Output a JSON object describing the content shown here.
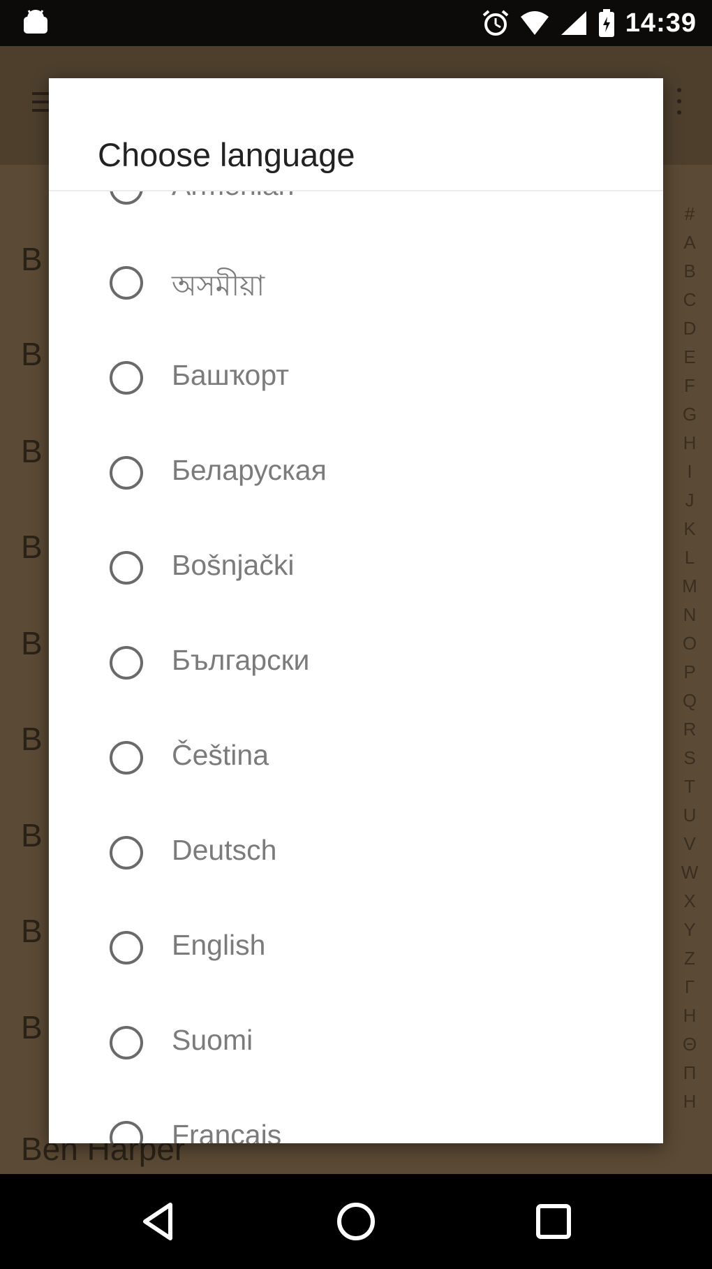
{
  "status_bar": {
    "time": "14:39",
    "icons": [
      "android-icon",
      "alarm-icon",
      "wifi-icon",
      "signal-icon",
      "battery-icon"
    ]
  },
  "background_app": {
    "artists": [
      "B",
      "B",
      "B",
      "B",
      "B",
      "B",
      "B",
      "B",
      "B",
      "Ben Harper"
    ],
    "index_letters": [
      "#",
      "A",
      "B",
      "C",
      "D",
      "E",
      "F",
      "G",
      "H",
      "I",
      "J",
      "K",
      "L",
      "M",
      "N",
      "O",
      "P",
      "Q",
      "R",
      "S",
      "T",
      "U",
      "V",
      "W",
      "X",
      "Y",
      "Z",
      "Γ",
      "Η",
      "Θ",
      "Π",
      "Η"
    ]
  },
  "dialog": {
    "title": "Choose language",
    "options": [
      {
        "label": "Armenian",
        "selected": false
      },
      {
        "label": "অসমীয়া",
        "selected": false
      },
      {
        "label": "Башҡорт",
        "selected": false
      },
      {
        "label": "Беларуская",
        "selected": false
      },
      {
        "label": "Bošnjački",
        "selected": false
      },
      {
        "label": "Български",
        "selected": false
      },
      {
        "label": "Čeština",
        "selected": false
      },
      {
        "label": "Deutsch",
        "selected": false
      },
      {
        "label": "English",
        "selected": false
      },
      {
        "label": "Suomi",
        "selected": false
      },
      {
        "label": "Français",
        "selected": false
      }
    ]
  },
  "nav_bar": {
    "buttons": [
      "back-icon",
      "home-icon",
      "recents-icon"
    ]
  }
}
